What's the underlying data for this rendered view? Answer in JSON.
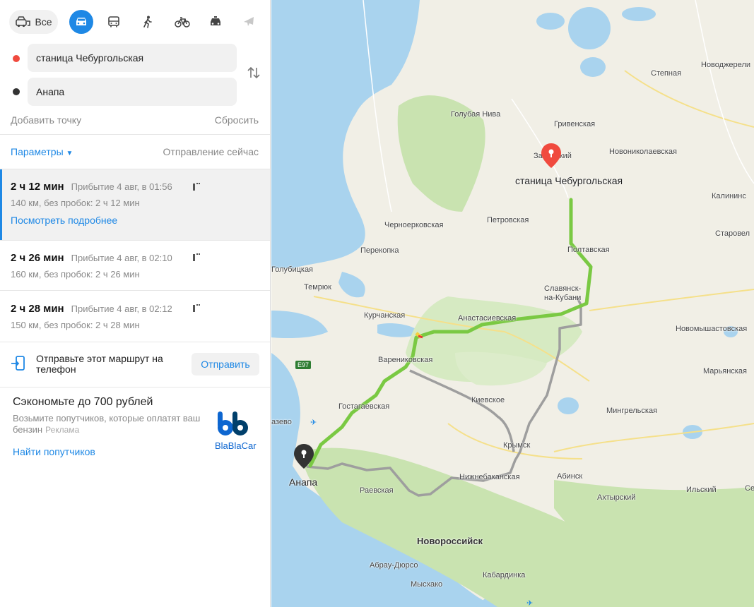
{
  "modes": {
    "all_label": "Все",
    "items": [
      "car-icon",
      "bus-icon",
      "walk-icon",
      "bike-icon",
      "taxi-icon",
      "plane-icon"
    ]
  },
  "route_points": {
    "from": "станица Чебургольская",
    "to": "Анапа",
    "add_point": "Добавить точку",
    "reset": "Сбросить"
  },
  "options": {
    "params": "Параметры",
    "departure": "Отправление сейчас"
  },
  "routes": [
    {
      "duration": "2 ч 12 мин",
      "arrival": "Прибытие 4 авг, в 01:56",
      "details": "140 км, без пробок: 2 ч 12 мин",
      "more": "Посмотреть подробнее"
    },
    {
      "duration": "2 ч 26 мин",
      "arrival": "Прибытие 4 авг, в 02:10",
      "details": "160 км, без пробок: 2 ч 26 мин"
    },
    {
      "duration": "2 ч 28 мин",
      "arrival": "Прибытие 4 авг, в 02:12",
      "details": "150 км, без пробок: 2 ч 28 мин"
    }
  ],
  "send": {
    "text": "Отправьте этот маршрут на телефон",
    "button": "Отправить"
  },
  "promo": {
    "title": "Сэкономьте до 700 рублей",
    "text": "Возьмите попутчиков, которые оплатят ваш бензин",
    "ad": "Реклама",
    "link": "Найти попутчиков",
    "logo_text": "BlaBlaCar"
  },
  "map": {
    "destination_label": "станица Чебургольская",
    "start_label": "Анапа",
    "road_badge": "E97",
    "places": {
      "stepnaya": "Степная",
      "novodzherel": "Новоджерели",
      "golubaya_niva": "Голубая Нива",
      "grivenskaya": "Гривенская",
      "zaboyskiy": "Забойский",
      "novonikolaevskaya": "Новониколаевская",
      "kalininskaya": "Калининс",
      "starovel": "Старовел",
      "petrovskaya": "Петровская",
      "chernoerkovskaya": "Черноерковская",
      "perekopka": "Перекопка",
      "poltavskaya": "Полтавская",
      "golubitskaya": "Голубицкая",
      "temryuk": "Темрюк",
      "slavyansk": "Славянск-на-Кубани",
      "kurchanskaya": "Курчанская",
      "anastasievskaya": "Анастасиевская",
      "novomyshastovskaya": "Новомышастовская",
      "varenikovskaya": "Варениковская",
      "maryanskaya": "Марьянская",
      "kievskoe": "Киевское",
      "gostagaevskaya": "Гостагаевская",
      "mingrelskaya": "Мингрельская",
      "dzhemete": "азево",
      "krymsk": "Крымск",
      "nizhnebakanskaya": "Нижнебаканская",
      "abinsk": "Абинск",
      "ilskiy": "Ильский",
      "se": "Се",
      "raevskaya": "Раевская",
      "akhtyrskiy": "Ахтырский",
      "novorossiysk": "Новороссийск",
      "abrau": "Абрау-Дюрсо",
      "kabardinka": "Кабардинка",
      "myskhako": "Мысхако"
    }
  },
  "colors": {
    "accent": "#1e88e5",
    "route_main": "#7ac943",
    "route_alt": "#9e9e9e",
    "sea": "#a9d3ee",
    "from_dot": "#f04a3e",
    "dest_pin": "#f04a3e",
    "start_pin": "#333333"
  }
}
